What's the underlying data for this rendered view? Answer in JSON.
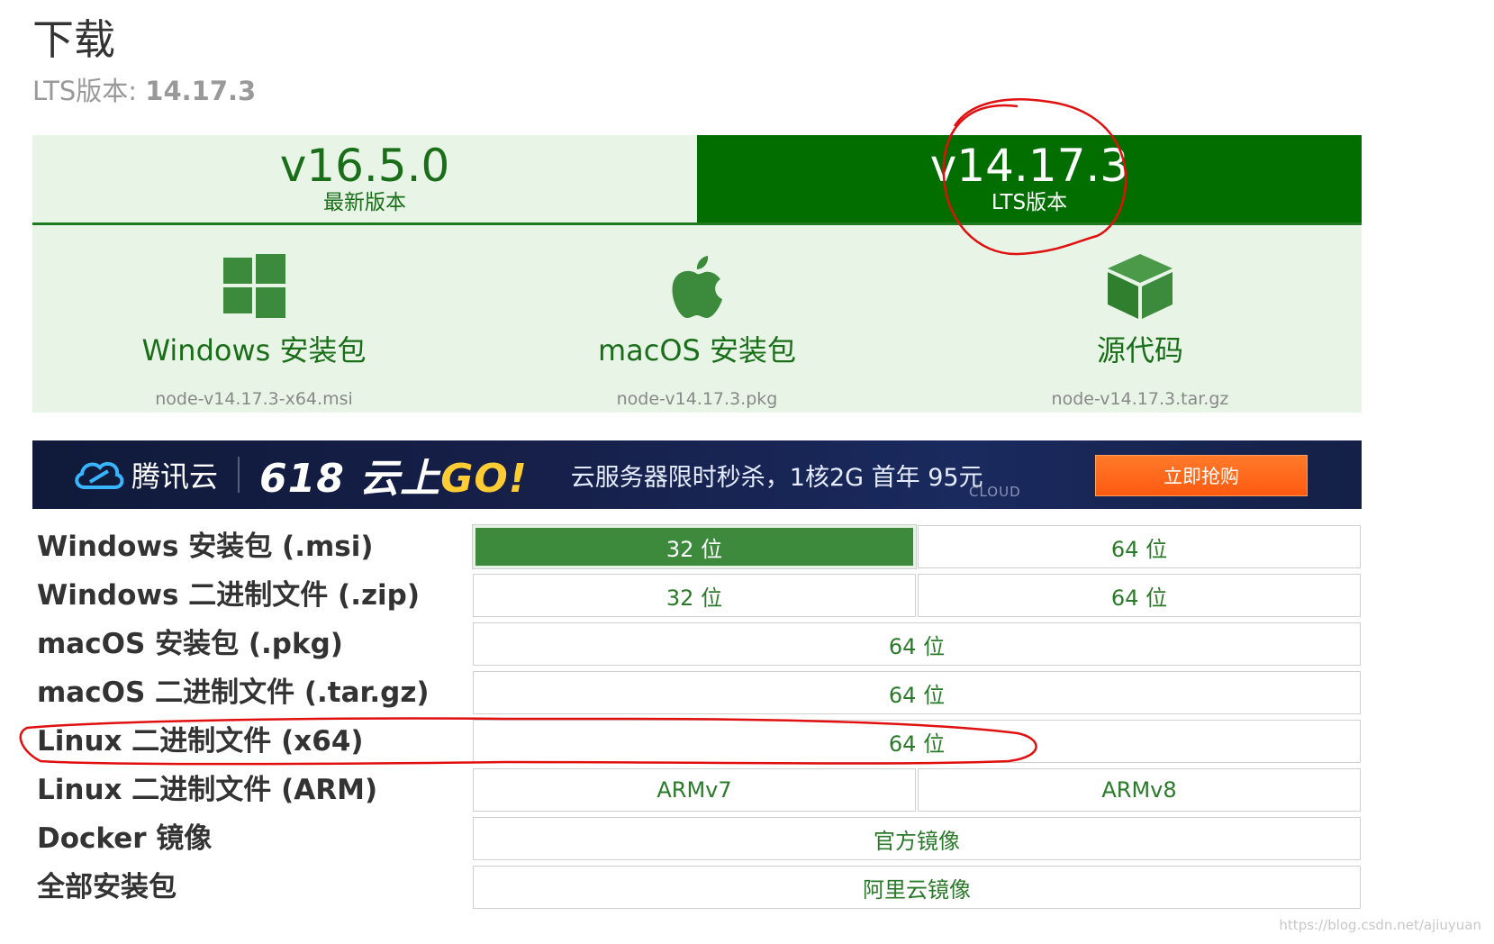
{
  "page": {
    "title": "下载",
    "lts_prefix": "LTS版本: ",
    "lts_version": "14.17.3"
  },
  "tabs": [
    {
      "version": "v16.5.0",
      "label": "最新版本",
      "state": "inactive"
    },
    {
      "version": "v14.17.3",
      "label": "LTS版本",
      "state": "active"
    }
  ],
  "cards": [
    {
      "icon": "windows-icon",
      "label": "Windows 安装包",
      "file": "node-v14.17.3-x64.msi"
    },
    {
      "icon": "apple-icon",
      "label": "macOS 安装包",
      "file": "node-v14.17.3.pkg"
    },
    {
      "icon": "cube-icon",
      "label": "源代码",
      "file": "node-v14.17.3.tar.gz"
    }
  ],
  "banner": {
    "brand": "腾讯云",
    "promo_num": "618",
    "promo_text": " 云上",
    "promo_go": "GO!",
    "offer": "云服务器限时秒杀，1核2G 首年 95元",
    "cloud_tag": "CLOUD",
    "cta": "立即抢购"
  },
  "downloads": [
    {
      "label": "Windows 安装包 (.msi)",
      "buttons": [
        "32 位",
        "64 位"
      ]
    },
    {
      "label": "Windows 二进制文件 (.zip)",
      "buttons": [
        "32 位",
        "64 位"
      ]
    },
    {
      "label": "macOS 安装包 (.pkg)",
      "buttons": [
        "64 位"
      ]
    },
    {
      "label": "macOS 二进制文件 (.tar.gz)",
      "buttons": [
        "64 位"
      ]
    },
    {
      "label": "Linux 二进制文件 (x64)",
      "buttons": [
        "64 位"
      ]
    },
    {
      "label": "Linux 二进制文件 (ARM)",
      "buttons": [
        "ARMv7",
        "ARMv8"
      ]
    },
    {
      "label": "Docker 镜像",
      "buttons": [
        "官方镜像"
      ]
    },
    {
      "label": "全部安装包",
      "buttons": [
        "阿里云镜像"
      ]
    }
  ],
  "colors": {
    "brand_green": "#026e00",
    "light_green": "#e8f5e6",
    "annotation_red": "#e01010"
  },
  "watermark": "https://blog.csdn.net/ajiuyuan"
}
